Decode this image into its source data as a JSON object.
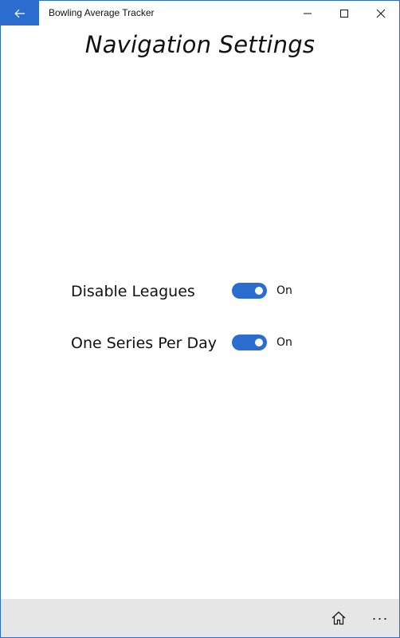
{
  "window": {
    "app_title": "Bowling Average Tracker",
    "accent_color": "#2b6ccf"
  },
  "page": {
    "title": "Navigation Settings"
  },
  "settings": [
    {
      "label": "Disable Leagues",
      "state": "On",
      "enabled": true
    },
    {
      "label": "One Series Per Day",
      "state": "On",
      "enabled": true
    }
  ],
  "commandbar": {
    "icons": [
      "home-icon",
      "more-icon"
    ],
    "more_glyph": "···"
  }
}
